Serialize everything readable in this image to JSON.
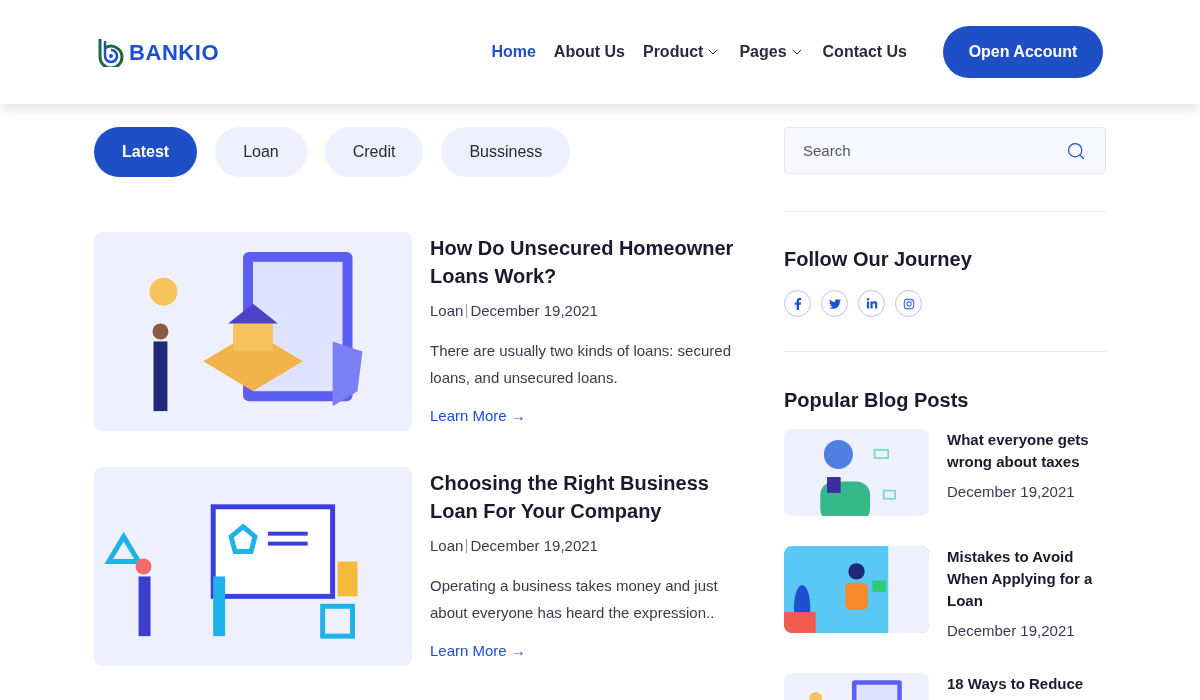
{
  "header": {
    "logo": "BANKIO",
    "nav": [
      {
        "label": "Home",
        "selected": true,
        "dropdown": false
      },
      {
        "label": "About Us",
        "selected": false,
        "dropdown": false
      },
      {
        "label": "Product",
        "selected": false,
        "dropdown": true
      },
      {
        "label": "Pages",
        "selected": false,
        "dropdown": true
      },
      {
        "label": "Contact Us",
        "selected": false,
        "dropdown": false
      }
    ],
    "cta": "Open Account"
  },
  "tabs": [
    {
      "label": "Latest",
      "selected": true
    },
    {
      "label": "Loan",
      "selected": false
    },
    {
      "label": "Credit",
      "selected": false
    },
    {
      "label": "Bussiness",
      "selected": false
    }
  ],
  "articles": [
    {
      "title": "How Do Unsecured Homeowner Loans Work?",
      "category": "Loan",
      "date": "December 19,2021",
      "excerpt": "There are usually two kinds of loans: secured loans, and unsecured loans.",
      "link": "Learn More →"
    },
    {
      "title": "Choosing the Right Business Loan For Your Company",
      "category": "Loan",
      "date": "December 19,2021",
      "excerpt": "Operating a business takes money and just about everyone has heard the expression..",
      "link": "Learn More →"
    }
  ],
  "sidebar": {
    "search": {
      "placeholder": "Search"
    },
    "follow_title": "Follow Our Journey",
    "social": [
      {
        "kind": "facebook"
      },
      {
        "kind": "twitter"
      },
      {
        "kind": "linkedin"
      },
      {
        "kind": "instagram"
      }
    ],
    "popular_title": "Popular Blog Posts",
    "posts": [
      {
        "title": "What everyone gets wrong about taxes",
        "date": "December 19,2021"
      },
      {
        "title": "Mistakes to Avoid When Applying for a Loan",
        "date": "December 19,2021"
      },
      {
        "title": "18 Ways to Reduce"
      }
    ]
  }
}
